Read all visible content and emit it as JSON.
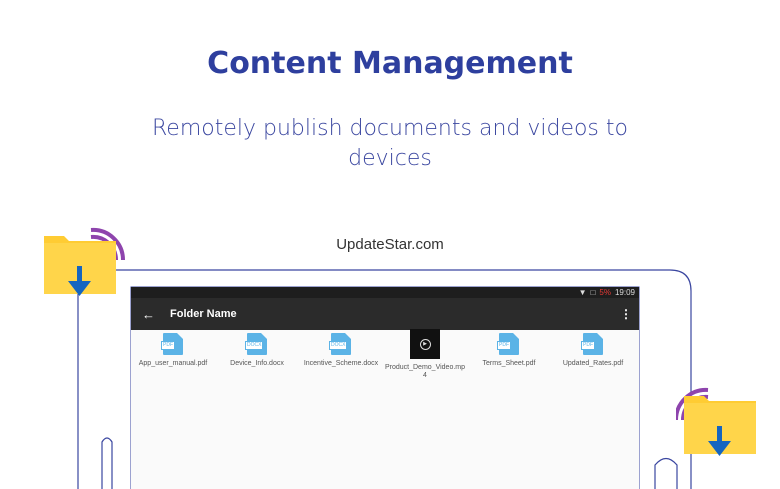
{
  "header": {
    "title": "Content Management",
    "subtitle": "Remotely publish documents and videos to devices",
    "watermark": "UpdateStar.com"
  },
  "statusbar": {
    "battery": "5%",
    "time": "19:09"
  },
  "appbar": {
    "folder_name": "Folder Name"
  },
  "files": [
    {
      "name": "App_user_manual.pdf",
      "type": "PDF",
      "icon": "pdf-file-icon"
    },
    {
      "name": "Device_Info.docx",
      "type": "DOCX",
      "icon": "docx-file-icon"
    },
    {
      "name": "Incentive_Scheme.docx",
      "type": "DOCX",
      "icon": "docx-file-icon"
    },
    {
      "name": "Product_Demo_Video.mp4",
      "type": "video",
      "icon": "video-thumbnail-icon"
    },
    {
      "name": "Terms_Sheet.pdf",
      "type": "PDF",
      "icon": "pdf-file-icon"
    },
    {
      "name": "Updated_Rates.pdf",
      "type": "PDF",
      "icon": "pdf-file-icon"
    }
  ],
  "colors": {
    "accent": "#2e3f9e",
    "folder": "#ffcc33",
    "arrow": "#1565c0",
    "signal": "#8e44ad",
    "file_icon": "#5bb3e6"
  }
}
